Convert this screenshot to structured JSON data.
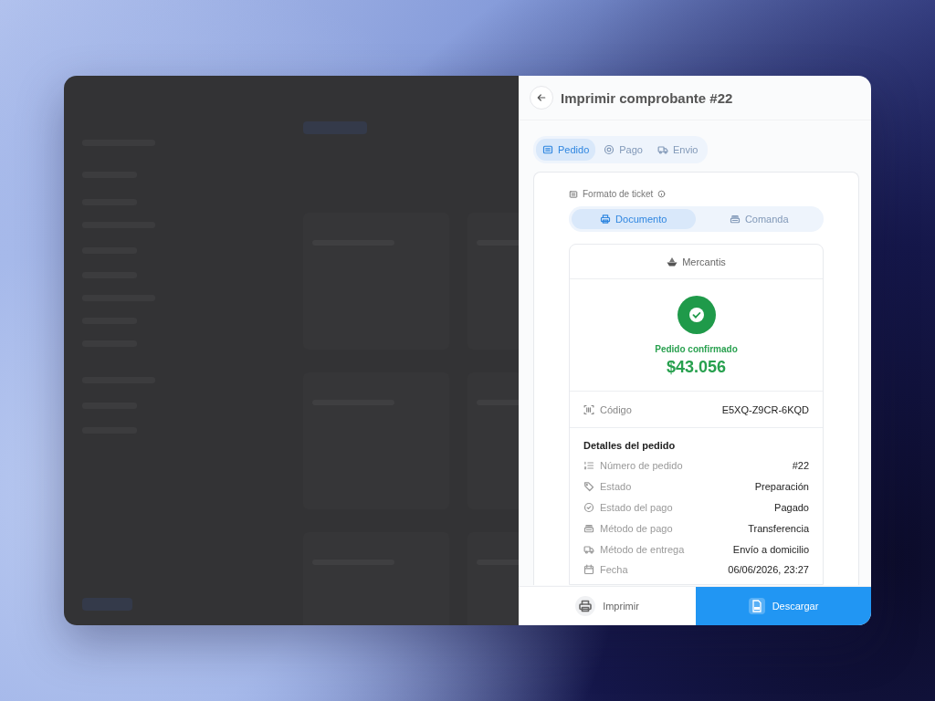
{
  "drawer": {
    "title": "Imprimir comprobante #22",
    "tabs": [
      {
        "label": "Pedido",
        "selected": true,
        "kind": "order"
      },
      {
        "label": "Pago",
        "selected": false,
        "kind": "payment"
      },
      {
        "label": "Envio",
        "selected": false,
        "kind": "shipping"
      }
    ],
    "format": {
      "label": "Formato de ticket",
      "options": [
        {
          "label": "Documento",
          "selected": true,
          "kind": "document"
        },
        {
          "label": "Comanda",
          "selected": false,
          "kind": "kitchen"
        }
      ]
    },
    "receipt": {
      "brand": "Mercantis",
      "status": "Pedido confirmado",
      "total": "$43.056",
      "code": {
        "label": "Código",
        "value": "E5XQ-Z9CR-6KQD"
      },
      "details_title": "Detalles del pedido",
      "details": [
        {
          "kind": "number",
          "label": "Número de pedido",
          "value": "#22"
        },
        {
          "kind": "status",
          "label": "Estado",
          "value": "Preparación"
        },
        {
          "kind": "payment_status",
          "label": "Estado del pago",
          "value": "Pagado"
        },
        {
          "kind": "payment_method",
          "label": "Método de pago",
          "value": "Transferencia"
        },
        {
          "kind": "delivery",
          "label": "Método de entrega",
          "value": "Envío a domicilio"
        },
        {
          "kind": "date",
          "label": "Fecha",
          "value": "06/06/2026, 23:27"
        }
      ]
    },
    "actions": [
      {
        "label": "Imprimir",
        "kind": "print"
      },
      {
        "label": "Descargar",
        "kind": "download"
      }
    ]
  }
}
